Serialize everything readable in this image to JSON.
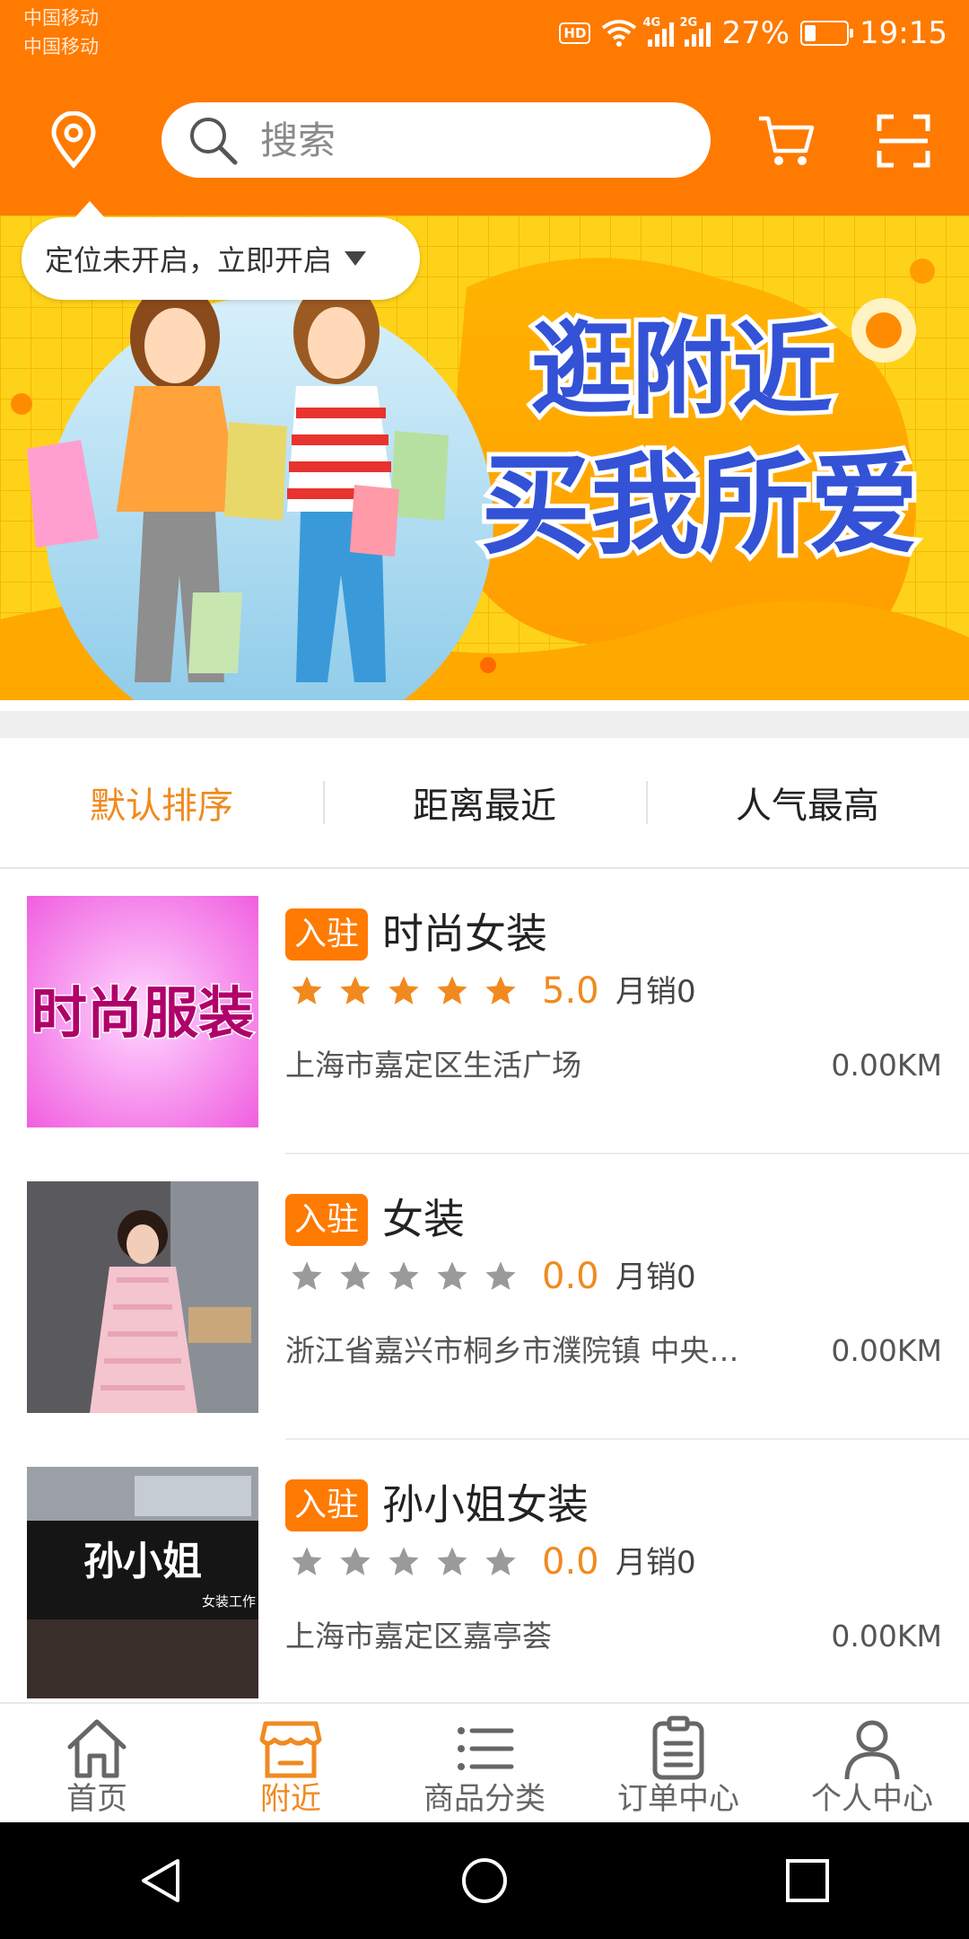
{
  "status_bar": {
    "carrier_1": "中国移动",
    "carrier_2": "中国移动",
    "hd": "HD",
    "net_1": "4G",
    "net_2": "2G",
    "battery": "27%",
    "time": "19:15"
  },
  "header": {
    "search_placeholder": "搜索",
    "location_tip": "定位未开启，立即开启"
  },
  "banner": {
    "line1": "逛附近",
    "line2": "买我所爱",
    "dots": 1
  },
  "sort_tabs": [
    {
      "label": "默认排序",
      "active": true
    },
    {
      "label": "距离最近",
      "active": false
    },
    {
      "label": "人气最高",
      "active": false
    }
  ],
  "shops": [
    {
      "badge": "入驻",
      "name": "时尚女装",
      "rating": 5,
      "score": "5.0",
      "sales": "月销0",
      "address": "上海市嘉定区生活广场",
      "distance": "0.00KM",
      "thumb_text": "时尚服装"
    },
    {
      "badge": "入驻",
      "name": "女装",
      "rating": 0,
      "score": "0.0",
      "sales": "月销0",
      "address": "浙江省嘉兴市桐乡市濮院镇  中央…",
      "distance": "0.00KM"
    },
    {
      "badge": "入驻",
      "name": "孙小姐女装",
      "rating": 0,
      "score": "0.0",
      "sales": "月销0",
      "address": "上海市嘉定区嘉亭荟",
      "distance": "0.00KM",
      "thumb_text": "孙小姐",
      "thumb_sub": "女装工作"
    }
  ],
  "bottom_nav": [
    {
      "label": "首页",
      "icon": "home-icon",
      "active": false
    },
    {
      "label": "附近",
      "icon": "store-icon",
      "active": true
    },
    {
      "label": "商品分类",
      "icon": "list-icon",
      "active": false
    },
    {
      "label": "订单中心",
      "icon": "clipboard-icon",
      "active": false
    },
    {
      "label": "个人中心",
      "icon": "person-icon",
      "active": false
    }
  ],
  "colors": {
    "brand": "#ff7a00",
    "accent_text": "#f08a1f",
    "star_active": "#f08a1f",
    "star_inactive": "#9a9a9a",
    "banner_yellow": "#ffd21a"
  }
}
